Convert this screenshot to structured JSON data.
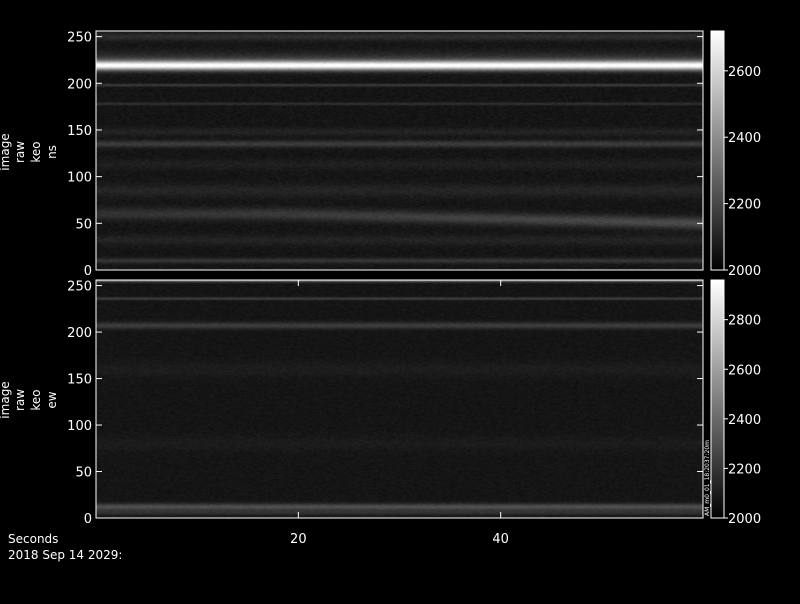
{
  "chart_data": [
    {
      "type": "heatmap",
      "ylabel": [
        "image",
        "raw",
        "keo",
        "ns"
      ],
      "ylim": [
        0,
        256
      ],
      "yticks": [
        0,
        50,
        100,
        150,
        200,
        250
      ],
      "xlim": [
        0,
        60
      ],
      "colorbar": {
        "range": [
          2000,
          2720
        ],
        "ticks": [
          2000,
          2200,
          2400,
          2600
        ]
      },
      "base_level": 2060,
      "noise": 18,
      "bands": [
        {
          "y": 219,
          "width": 3.5,
          "amp": 620
        },
        {
          "y": 225,
          "width": 6,
          "amp": 90
        },
        {
          "y": 198,
          "width": 1.0,
          "amp": 110
        },
        {
          "y": 178,
          "width": 1.0,
          "amp": 80
        },
        {
          "y": 135,
          "width": 2.5,
          "amp": 110
        },
        {
          "y": 148,
          "width": 3,
          "amp": 40
        },
        {
          "y": 113,
          "width": 4,
          "amp": 30
        },
        {
          "y": 85,
          "width": 5,
          "amp": 45
        },
        {
          "y": 60,
          "y_end": 50,
          "width": 4.5,
          "amp": 140
        },
        {
          "y": 32,
          "width": 4,
          "amp": 40
        },
        {
          "y": 10,
          "width": 2,
          "amp": 90
        },
        {
          "y": 250,
          "width": 3,
          "amp": 70
        }
      ]
    },
    {
      "type": "heatmap",
      "ylabel": [
        "image",
        "raw",
        "keo",
        "ew"
      ],
      "ylim": [
        0,
        256
      ],
      "yticks": [
        0,
        50,
        100,
        150,
        200,
        250
      ],
      "xlim": [
        0,
        60
      ],
      "xticks": [
        20,
        40
      ],
      "colorbar": {
        "range": [
          2000,
          2960
        ],
        "ticks": [
          2000,
          2200,
          2400,
          2600,
          2800
        ]
      },
      "base_level": 2080,
      "noise": 20,
      "bands": [
        {
          "y": 256,
          "width": 1.5,
          "amp": 400
        },
        {
          "y": 236,
          "width": 1.0,
          "amp": 160
        },
        {
          "y": 207,
          "width": 2.5,
          "amp": 150
        },
        {
          "y": 12,
          "width": 2.5,
          "amp": 220
        },
        {
          "y": 6,
          "width": 2,
          "amp": 100
        },
        {
          "y": 160,
          "width": 6,
          "amp": 30
        },
        {
          "y": 80,
          "width": 6,
          "amp": 25
        }
      ],
      "side_label": "AM_m0_01_18:2037:20m"
    }
  ],
  "footer": {
    "xaxis_label": "Seconds",
    "date_label": "2018 Sep 14 2029:"
  }
}
